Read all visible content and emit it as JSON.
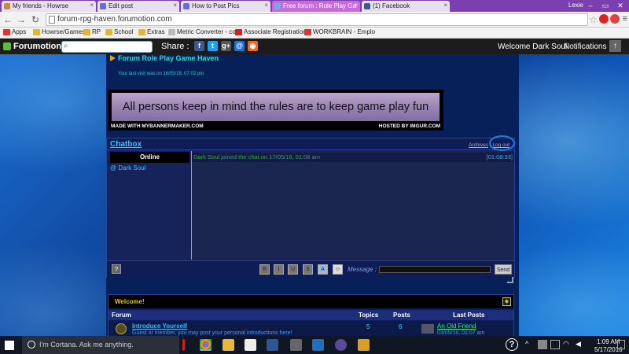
{
  "browser": {
    "tabs": [
      {
        "label": "My friends - Howrse",
        "active": false,
        "favicon_color": "#c9873a"
      },
      {
        "label": "Edit post",
        "active": false,
        "favicon_color": "#6a6ad0"
      },
      {
        "label": "How to Post Pics",
        "active": false,
        "favicon_color": "#6a6ad0"
      },
      {
        "label": "Free forum : Role Play Ga",
        "active": true,
        "favicon_color": "#7aa8e8"
      },
      {
        "label": "(1) Facebook",
        "active": false,
        "favicon_color": "#3b5998"
      }
    ],
    "profile_name": "Lexie",
    "url": "forum-rpg-haven.forumotion.com",
    "bookmarks": [
      "Apps",
      "Howrse/Games",
      "RP",
      "School",
      "Extras",
      "Metric Converter - co",
      "Associate Registration",
      "WORKBRAIN - Emplo"
    ]
  },
  "forumotion_bar": {
    "logo": "Forumotion",
    "share_label": "Share :",
    "share_icons": [
      {
        "name": "facebook-icon",
        "glyph": "f",
        "color": "#3b5998"
      },
      {
        "name": "twitter-icon",
        "glyph": "t",
        "color": "#1da1f2"
      },
      {
        "name": "googleplus-icon",
        "glyph": "g+",
        "color": "#555555"
      },
      {
        "name": "email-icon",
        "glyph": "@",
        "color": "#1e6fd9"
      },
      {
        "name": "rss-icon",
        "glyph": "◉",
        "color": "#f26522"
      }
    ],
    "welcome": "Welcome Dark Soul",
    "notifications": "Notifications"
  },
  "forum": {
    "title": "Forum Role Play Game Haven",
    "last_visit": "Your last visit was on 16/05/16, 07:02 pm"
  },
  "banner": {
    "text": "All persons keep in mind the rules are to keep game play fun",
    "foot_left": "MADE WITH MYBANNERMAKER.COM",
    "foot_right": "HOSTED BY IMGUR.COM"
  },
  "chatbox": {
    "title": "Chatbox",
    "archives": "Archives",
    "logout": "Log out",
    "online_header": "Online",
    "users": [
      "@ Dark Soul"
    ],
    "messages": [
      {
        "text": "Dark Soul joined the chat on 17/05/16, 01:08 am",
        "time": "[01:08:33]"
      }
    ],
    "help_button": "?",
    "format_buttons": [
      "B",
      "I",
      "U",
      "S",
      "A",
      "☺"
    ],
    "message_label": "Message :",
    "message_value": "",
    "send_label": "Send"
  },
  "forum_table": {
    "welcome": "Welcome!",
    "headers": {
      "forum": "Forum",
      "topics": "Topics",
      "posts": "Posts",
      "last_posts": "Last Posts"
    },
    "rows": [
      {
        "name": "Introduce Yourself",
        "desc": "Guest or member, you may post your personal introductions here!",
        "topics": "5",
        "posts": "6",
        "last_post_title": "An Old Friend",
        "last_post_date": "03/05/16, 01:07 am"
      }
    ]
  },
  "taskbar": {
    "cortana": "I'm Cortana. Ask me anything.",
    "time": "1:09 AM",
    "date": "5/17/2016"
  },
  "colors": {
    "accent": "#7b3fb0",
    "chat_title": "#22ccff",
    "join_message": "#2aaa44"
  }
}
